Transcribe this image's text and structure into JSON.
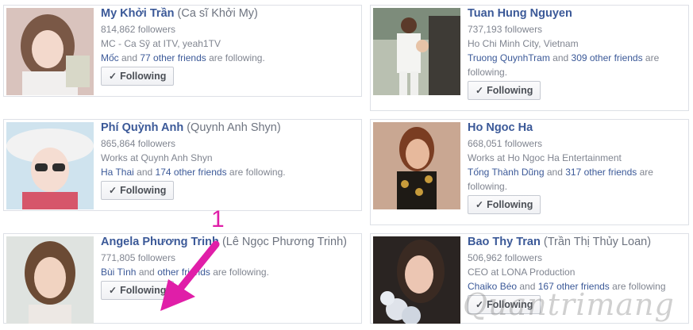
{
  "cards": [
    {
      "name": "My Khởi Trần",
      "alt_name": "(Ca sĩ Khởi My)",
      "followers": "814,862 followers",
      "work": "MC - Ca Sỹ at ITV, yeah1TV",
      "friend": "Mốc",
      "and1": " and ",
      "others": "77 other friends",
      "suffix": " are following.",
      "button": "Following"
    },
    {
      "name": "Tuan Hung Nguyen",
      "alt_name": "",
      "followers": "737,193 followers",
      "work": "Ho Chi Minh City, Vietnam",
      "friend": "Truong QuynhTram",
      "and1": " and ",
      "others": "309 other friends",
      "suffix": " are following.",
      "button": "Following"
    },
    {
      "name": "Phí Quỳnh Anh",
      "alt_name": "(Quynh Anh Shyn)",
      "followers": "865,864 followers",
      "work": "Works at Quynh Anh Shyn",
      "friend": "Ha Thai",
      "and1": " and ",
      "others": "174 other friends",
      "suffix": " are following.",
      "button": "Following"
    },
    {
      "name": "Ho Ngoc Ha",
      "alt_name": "",
      "followers": "668,051 followers",
      "work": "Works at Ho Ngoc Ha Entertainment",
      "friend": "Tống Thành Dũng",
      "and1": " and ",
      "others": "317 other friends",
      "suffix": " are following.",
      "button": "Following"
    },
    {
      "name": "Angela Phương Trinh",
      "alt_name": "(Lê Ngọc Phương Trinh)",
      "followers": "771,805 followers",
      "work": "",
      "friend": "Bùi Tình",
      "and1": " and ",
      "others": "other friends",
      "suffix": " are following.",
      "button": "Following"
    },
    {
      "name": "Bao Thy Tran",
      "alt_name": "(Trần Thị Thủy Loan)",
      "followers": "506,962 followers",
      "work": "CEO at LONA Production",
      "friend": "Chaiko Béo",
      "and1": " and ",
      "others": "167 other friends",
      "suffix": " are following",
      "button": "Following"
    }
  ],
  "annotation": {
    "step_number": "1",
    "color": "#e01ea8"
  },
  "watermark": "Quantrimang",
  "colors": {
    "link": "#3b5998",
    "muted": "#808590",
    "border": "#dde0e6"
  },
  "icons": {
    "button_icon": "check-icon"
  }
}
